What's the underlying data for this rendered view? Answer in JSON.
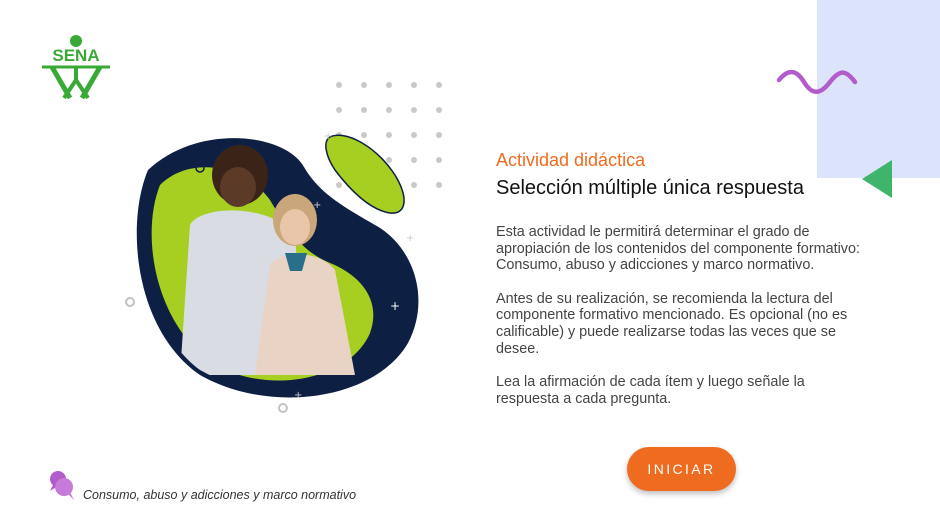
{
  "logo": {
    "text": "SENA"
  },
  "activity": {
    "subtitle": "Actividad didáctica",
    "title": "Selección múltiple única respuesta"
  },
  "description": {
    "p1": "Esta actividad le permitirá determinar el grado de apropiación de los contenidos del componente formativo: Consumo, abuso y adicciones y marco normativo.",
    "p2": "Antes de su realización, se recomienda la lectura del componente formativo mencionado. Es opcional (no es calificable) y puede realizarse todas las veces que se desee.",
    "p3": "Lea la afirmación de cada ítem y luego señale la respuesta a cada pregunta."
  },
  "start_button": {
    "label": "INICIAR"
  },
  "footer": {
    "course_name": "Consumo, abuso y adicciones y marco normativo"
  },
  "colors": {
    "accent_orange": "#ef6b1f",
    "sena_green": "#39a935",
    "lime": "#a6cf22",
    "navy": "#0e1f44",
    "wave_purple": "#b25ccc",
    "triangle_green": "#3eb56a",
    "panel_blue": "#dce4fb"
  },
  "icons": [
    "sena-logo",
    "wave-decoration",
    "triangle-decoration",
    "chat-bubbles-icon"
  ]
}
